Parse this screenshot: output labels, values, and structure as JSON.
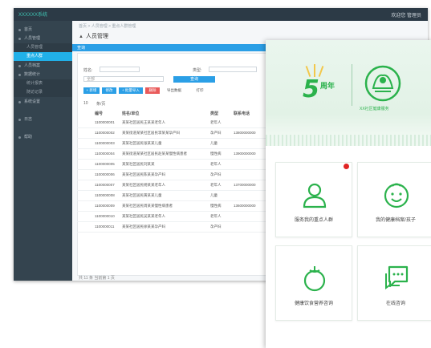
{
  "admin": {
    "logo": "XXXXXX系统",
    "user": "欢迎您 管理员",
    "breadcrumb": "首页 > 人员管理 > 重点人群管理",
    "page_title": "人员管理",
    "panel_tab": "查询",
    "sidebar": [
      {
        "label": "首页",
        "sub": false,
        "active": false
      },
      {
        "label": "人员管理",
        "sub": false,
        "active": false
      },
      {
        "label": "人员管理",
        "sub": true,
        "active": false
      },
      {
        "label": "重点人群",
        "sub": true,
        "active": true
      },
      {
        "label": "人员档案",
        "sub": false,
        "active": false
      },
      {
        "label": "数据统计",
        "sub": false,
        "active": false
      },
      {
        "label": "统计报表",
        "sub": true,
        "active": false
      },
      {
        "label": "随访记录",
        "sub": true,
        "active": false
      },
      {
        "label": "系统设置",
        "sub": false,
        "active": false
      },
      {
        "label": "日志",
        "sub": false,
        "active": false
      },
      {
        "label": "帮助",
        "sub": false,
        "active": false
      }
    ],
    "filters": {
      "name_label": "姓名:",
      "type_label": "类型:",
      "area_placeholder": "全部",
      "search_button": "查询"
    },
    "toolbar": [
      "+ 新增",
      "修改",
      "+ 批量导入",
      "删除",
      "导出数据",
      "打印"
    ],
    "meta": {
      "page_size": "10",
      "meta_text": "条/页"
    },
    "table": {
      "headers": [
        "编号",
        "姓名/单位",
        "类型",
        "联系电话"
      ],
      "rows": [
        [
          "1100000001",
          "某某社区居民王某某老年人",
          "老年人",
          ""
        ],
        [
          "1100000002",
          "某某街道某某社区居民李某某孕产妇",
          "孕产妇",
          "13800000000"
        ],
        [
          "1100000003",
          "某某社区居民张某某儿童",
          "儿童",
          ""
        ],
        [
          "1100000004",
          "某某街道某某社区居民赵某某慢性病患者",
          "慢性病",
          "13900000000"
        ],
        [
          "1100000005",
          "某某社区居民刘某某",
          "老年人",
          ""
        ],
        [
          "1100000006",
          "某某社区居民陈某某孕产妇",
          "孕产妇",
          ""
        ],
        [
          "1100000007",
          "某某社区居民杨某某老年人",
          "老年人",
          "13700000000"
        ],
        [
          "1100000008",
          "某某社区居民黄某某儿童",
          "儿童",
          ""
        ],
        [
          "1100000009",
          "某某社区居民周某某慢性病患者",
          "慢性病",
          "13600000000"
        ],
        [
          "1100000010",
          "某某社区居民吴某某老年人",
          "老年人",
          ""
        ],
        [
          "1100000011",
          "某某社区居民徐某某孕产妇",
          "孕产妇",
          ""
        ]
      ]
    },
    "footer": "共 11 条 当前第 1 页"
  },
  "mobile": {
    "badge_number": "5",
    "badge_word": "周年",
    "emblem_caption": "XX社区健康服务",
    "cards": [
      {
        "label": "服务我的重点人群",
        "icon": "person-icon",
        "notify": true
      },
      {
        "label": "我的健康档案/孩子",
        "icon": "child-face-icon",
        "notify": false
      },
      {
        "label": "健康饮食营养咨询",
        "icon": "tomato-icon",
        "notify": false
      },
      {
        "label": "在线咨询",
        "icon": "chat-icon",
        "notify": false
      }
    ],
    "accent_color": "#2bb24c",
    "notify_color": "#e02424"
  }
}
